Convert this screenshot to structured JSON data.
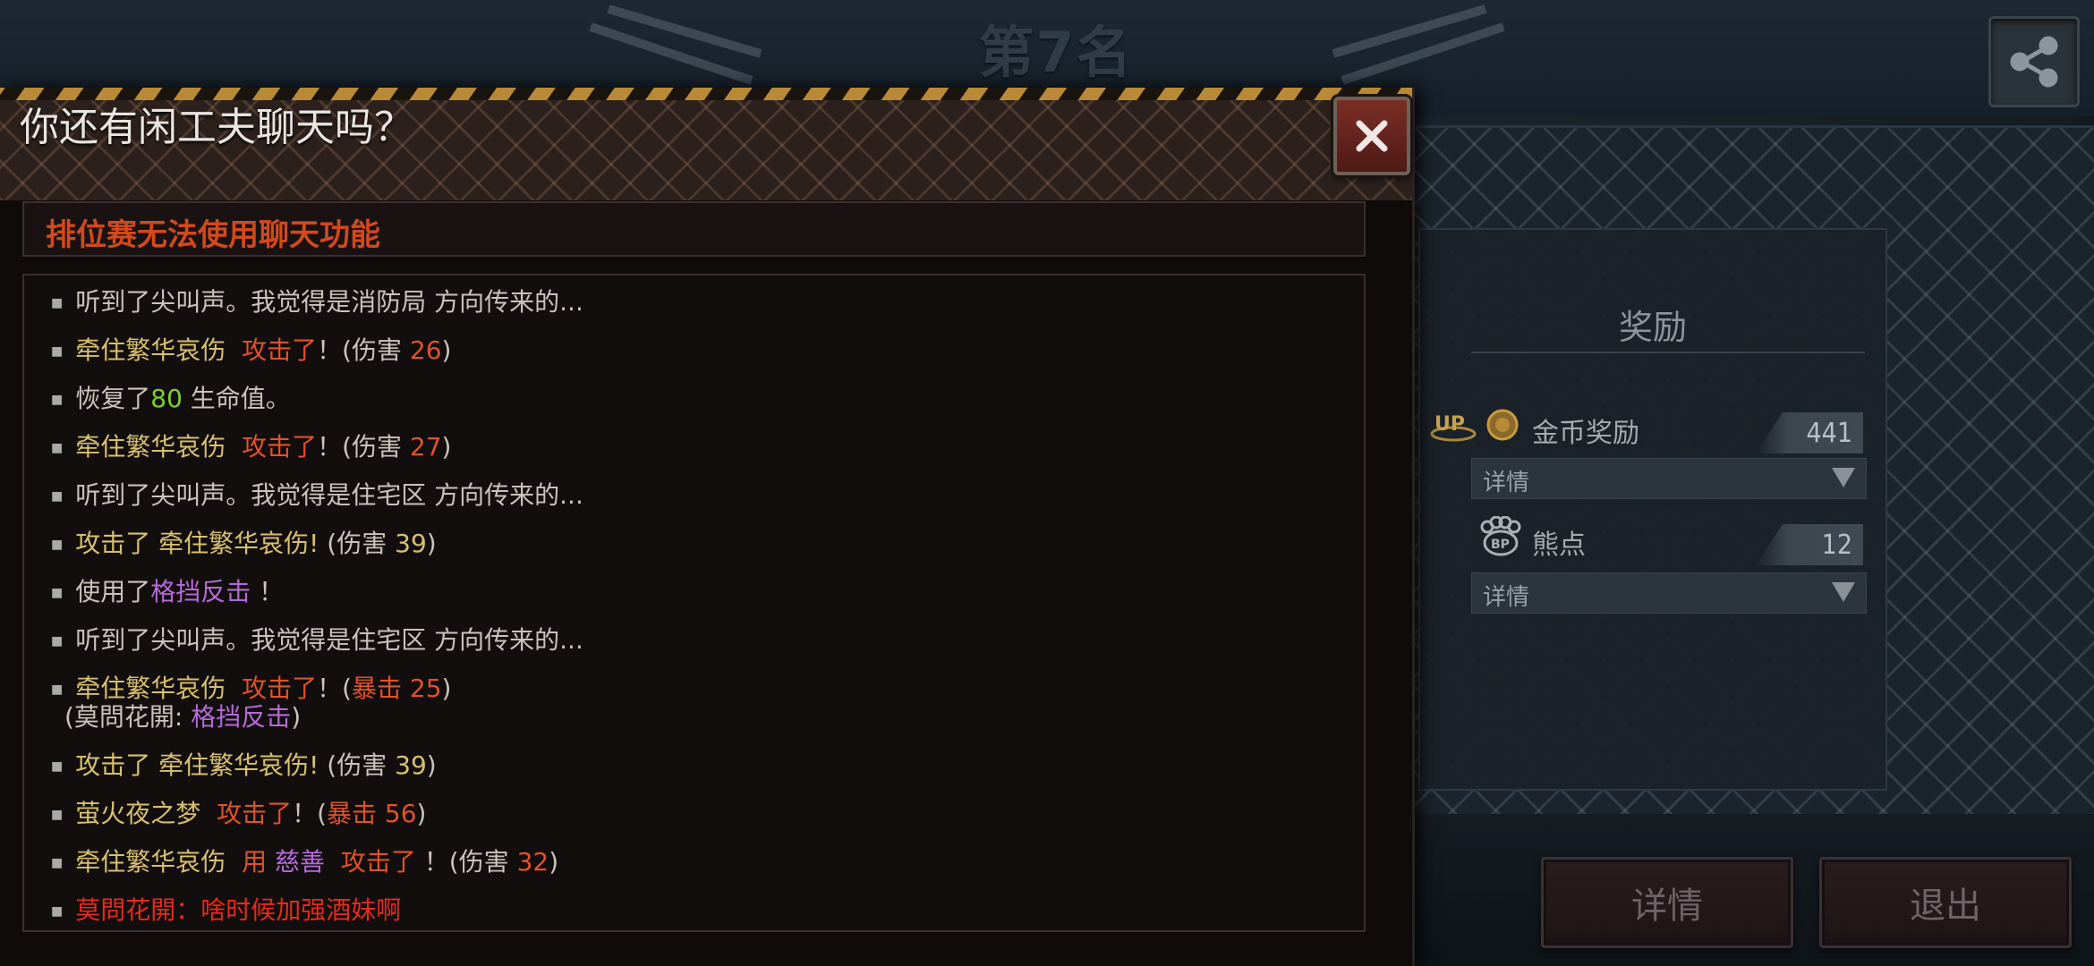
{
  "rank_title": "第7名",
  "modal": {
    "title": "你还有闲工夫聊天吗？",
    "notice": "排位赛无法使用聊天功能"
  },
  "chat": {
    "l1": {
      "a": "听到了尖叫声。我觉得是消防局 方向传来的..."
    },
    "l2": {
      "name": "牵住繁华哀伤",
      "attack": "攻击了",
      "mid": "！(伤害 ",
      "num": "26",
      "end": ")"
    },
    "l3": {
      "pre": "恢复了",
      "num": "80",
      "post": " 生命值。"
    },
    "l4": {
      "name": "牵住繁华哀伤",
      "attack": "攻击了",
      "mid": "！(伤害 ",
      "num": "27",
      "end": ")"
    },
    "l5": {
      "a": "听到了尖叫声。我觉得是住宅区 方向传来的..."
    },
    "l6": {
      "attack": "攻击了",
      "target": "牵住繁华哀伤!",
      "mid": " (伤害 ",
      "num": "39",
      "end": ")"
    },
    "l7": {
      "pre": "使用了",
      "skill": "格挡反击",
      "end": " ！"
    },
    "l8": {
      "a": "听到了尖叫声。我觉得是住宅区 方向传来的..."
    },
    "l9": {
      "name": "牵住繁华哀伤",
      "attack": "攻击了",
      "mid": "！(",
      "crit": "暴击 25",
      "end": ")",
      "sub_pre": "(莫問花開: ",
      "sub_skill": "格挡反击",
      "sub_end": ")"
    },
    "l10": {
      "attack": "攻击了",
      "target": "牵住繁华哀伤!",
      "mid": " (伤害 ",
      "num": "39",
      "end": ")"
    },
    "l11": {
      "name": "萤火夜之梦",
      "attack": "攻击了",
      "mid": "！(",
      "crit": "暴击 56",
      "end": ")"
    },
    "l12": {
      "name": "牵住繁华哀伤",
      "use": "用",
      "item": "慈善",
      "attack": "攻击了",
      "mid": " ！(伤害 ",
      "num": "32",
      "end": ")"
    },
    "l13": {
      "a": "莫問花開：啥时候加强酒妹啊"
    }
  },
  "rewards": {
    "title": "奖励",
    "gold_label": "金币奖励",
    "gold_value": "441",
    "gold_detail": "详情",
    "bear_label": "熊点",
    "bear_value": "12",
    "bear_detail": "详情"
  },
  "buttons": {
    "details": "详情",
    "exit": "退出"
  },
  "colors": {
    "attack": "#e0522a",
    "name": "#d7c070",
    "heal": "#7ccf2f",
    "skill": "#b56ad9",
    "chat_user": "#e52a1c",
    "hazard_stripe": "#b88a37"
  },
  "icons": [
    "share-icon",
    "close-icon",
    "up-badge-icon",
    "coin-icon",
    "bear-paw-icon",
    "dropdown-arrow-icon"
  ]
}
